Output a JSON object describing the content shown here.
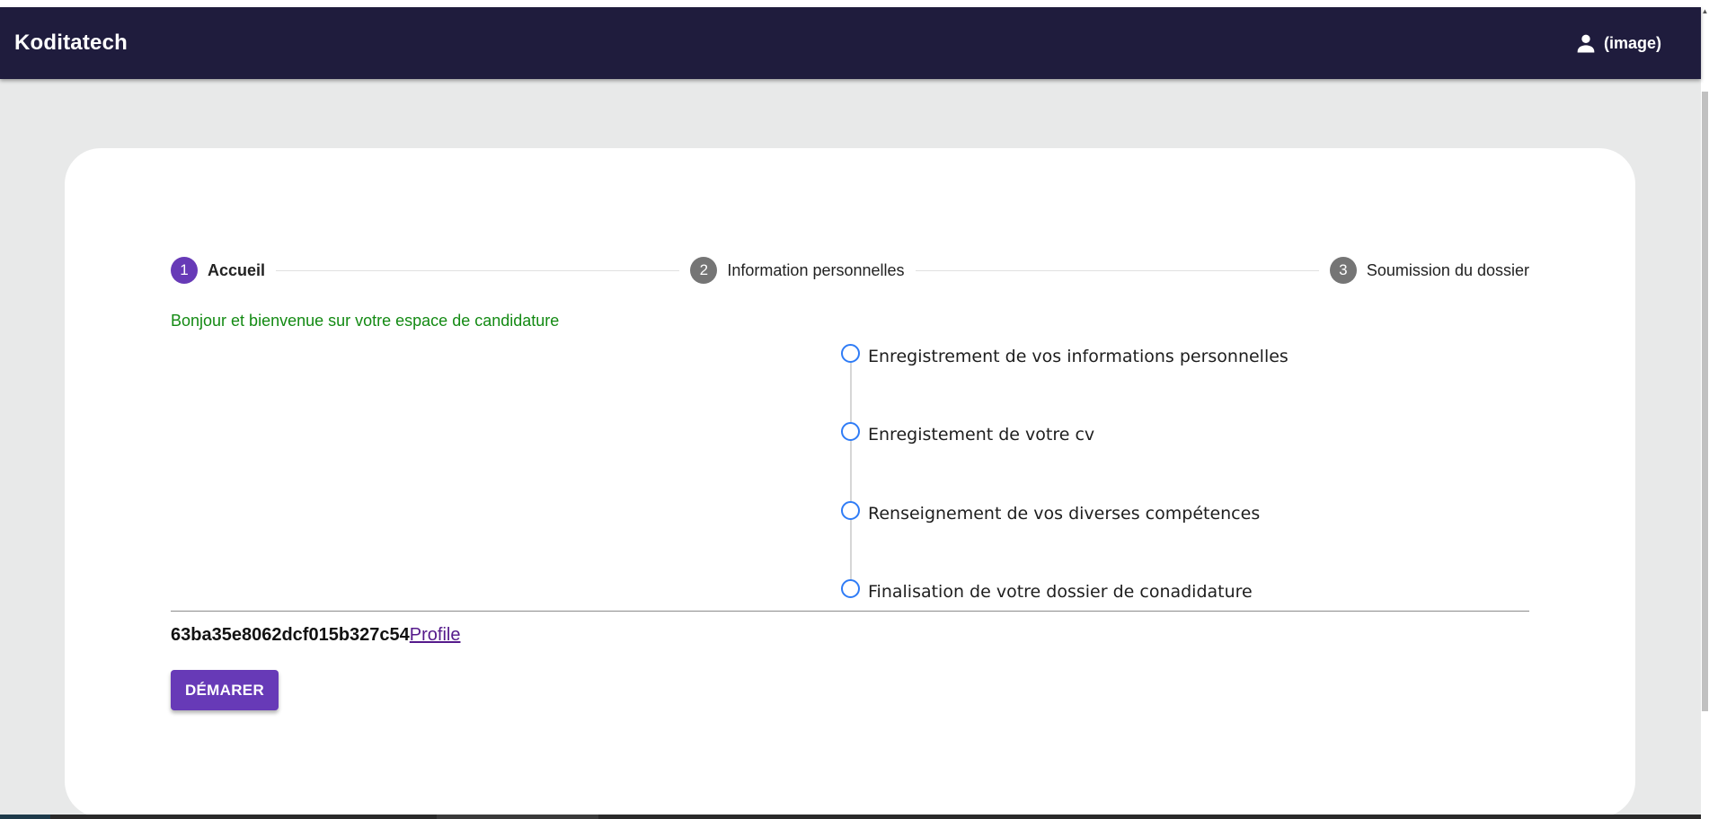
{
  "app": {
    "brand": "Koditatech",
    "user_label": "(image)"
  },
  "stepper": {
    "steps": [
      {
        "number": "1",
        "label": "Accueil",
        "state": "active"
      },
      {
        "number": "2",
        "label": "Information personnelles",
        "state": "inactive"
      },
      {
        "number": "3",
        "label": "Soumission du dossier",
        "state": "inactive"
      }
    ]
  },
  "main": {
    "welcome": "Bonjour et bienvenue sur votre espace de candidature",
    "timeline": [
      "Enregistrement de vos informations personnelles",
      "Enregistement de votre cv",
      "Renseignement de vos diverses compétences",
      "Finalisation de votre dossier de conadidature"
    ],
    "user_id": "63ba35e8062dcf015b327c54",
    "profile_link": "Profile",
    "start_button": "DÉMARER"
  },
  "colors": {
    "app_bar": "#1f1c3d",
    "primary": "#673ab7",
    "welcome_text": "#138a13",
    "timeline_dot": "#2f7cf6",
    "page_bg": "#e8e9e9"
  },
  "icons": {
    "user": "person-icon"
  }
}
